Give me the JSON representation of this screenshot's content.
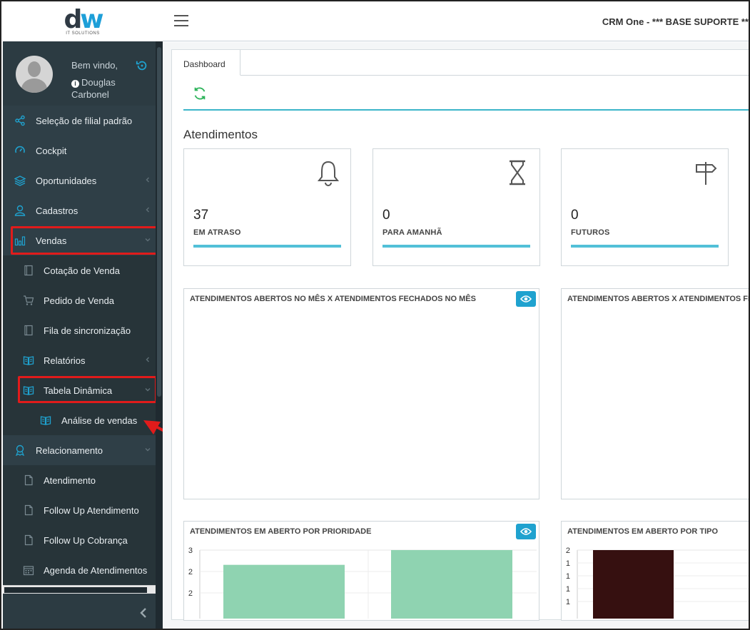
{
  "header": {
    "logo_text": "dw",
    "logo_subtitle": "IT SOLUTIONS",
    "title": "CRM One - *** BASE SUPORTE **"
  },
  "user": {
    "welcome": "Bem vindo,",
    "name": "Douglas Carbonel"
  },
  "sidebar": {
    "items": [
      {
        "label": "Seleção de filial padrão",
        "icon": "share-icon",
        "level": 0,
        "chevron": ""
      },
      {
        "label": "Cockpit",
        "icon": "dashboard-gauge-icon",
        "level": 0,
        "chevron": ""
      },
      {
        "label": "Oportunidades",
        "icon": "layers-icon",
        "level": 0,
        "chevron": "left"
      },
      {
        "label": "Cadastros",
        "icon": "user-icon",
        "level": 0,
        "chevron": "left"
      },
      {
        "label": "Vendas",
        "icon": "bar-chart-icon",
        "level": 0,
        "chevron": "down"
      },
      {
        "label": "Cotação de Venda",
        "icon": "document-icon",
        "level": 1,
        "chevron": ""
      },
      {
        "label": "Pedido de Venda",
        "icon": "cart-icon",
        "level": 1,
        "chevron": ""
      },
      {
        "label": "Fila de sincronização",
        "icon": "document-icon",
        "level": 1,
        "chevron": ""
      },
      {
        "label": "Relatórios",
        "icon": "book-icon",
        "level": 1,
        "chevron": "left"
      },
      {
        "label": "Tabela Dinâmica",
        "icon": "book-icon",
        "level": 1,
        "chevron": "down"
      },
      {
        "label": "Análise de vendas",
        "icon": "book-icon",
        "level": 2,
        "chevron": ""
      },
      {
        "label": "Relacionamento",
        "icon": "award-icon",
        "level": 0,
        "chevron": "down"
      },
      {
        "label": "Atendimento",
        "icon": "file-icon",
        "level": 1,
        "chevron": ""
      },
      {
        "label": "Follow Up Atendimento",
        "icon": "file-icon",
        "level": 1,
        "chevron": ""
      },
      {
        "label": "Follow Up Cobrança",
        "icon": "file-icon",
        "level": 1,
        "chevron": ""
      },
      {
        "label": "Agenda de Atendimentos",
        "icon": "calendar-icon",
        "level": 1,
        "chevron": ""
      }
    ]
  },
  "main": {
    "tab": "Dashboard",
    "section_title": "Atendimentos",
    "stats": [
      {
        "value": "37",
        "label": "EM ATRASO",
        "icon": "bell-icon"
      },
      {
        "value": "0",
        "label": "PARA AMANHÃ",
        "icon": "hourglass-icon"
      },
      {
        "value": "0",
        "label": "FUTUROS",
        "icon": "signpost-icon"
      }
    ],
    "charts": [
      {
        "title": "ATENDIMENTOS ABERTOS NO MÊS X ATENDIMENTOS FECHADOS NO MÊS"
      },
      {
        "title": "ATENDIMENTOS ABERTOS X ATENDIMENTOS FECHADOS"
      },
      {
        "title": "ATENDIMENTOS EM ABERTO POR PRIORIDADE"
      },
      {
        "title": "ATENDIMENTOS EM ABERTO POR TIPO"
      }
    ]
  },
  "colors": {
    "sidebar_bg": "#2c3b42",
    "accent": "#1fa2cf",
    "stat_bar": "#52c0d8",
    "highlight": "#e11b1b",
    "bar_green": "#8fd3b1",
    "bar_dark": "#361010"
  },
  "chart_data": [
    {
      "type": "bar",
      "y_tick_labels": [
        "3",
        "2",
        "2"
      ],
      "series": [
        {
          "values": [
            2,
            3
          ]
        }
      ]
    },
    {
      "type": "bar",
      "y_tick_labels": [
        "2",
        "1",
        "1",
        "1",
        "1"
      ],
      "series": [
        {
          "values": [
            2
          ]
        }
      ]
    }
  ]
}
